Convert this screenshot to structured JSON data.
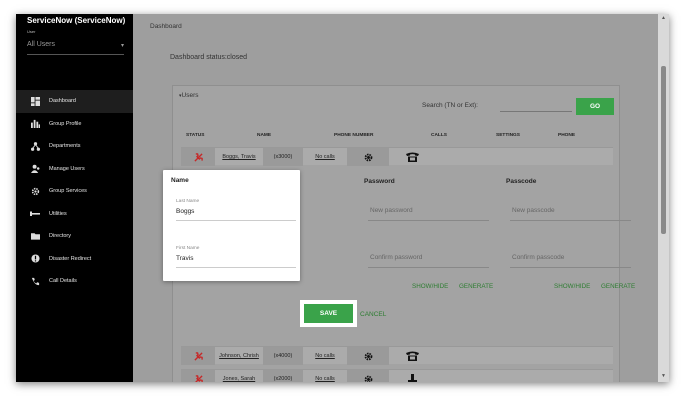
{
  "sidebar": {
    "app_title": "ServiceNow (ServiceNow)",
    "user_label": "User",
    "user_select": "All Users",
    "items": [
      {
        "label": "Dashboard",
        "icon": "dashboard-icon"
      },
      {
        "label": "Group Profile",
        "icon": "bar-chart-icon"
      },
      {
        "label": "Departments",
        "icon": "org-chart-icon"
      },
      {
        "label": "Manage Users",
        "icon": "users-icon"
      },
      {
        "label": "Group Services",
        "icon": "gear-icon"
      },
      {
        "label": "Utilities",
        "icon": "wrench-icon"
      },
      {
        "label": "Directory",
        "icon": "folder-icon"
      },
      {
        "label": "Disaster Redirect",
        "icon": "alert-icon"
      },
      {
        "label": "Call Details",
        "icon": "phone-icon"
      }
    ]
  },
  "main": {
    "breadcrumb": "Dashboard",
    "status": "Dashboard status:closed",
    "users_toggle": "Users",
    "search_label": "Search (TN or Ext):",
    "search_value": "",
    "go_label": "GO",
    "headers": {
      "status": "STATUS",
      "name": "NAME",
      "phone": "PHONE NUMBER",
      "calls": "CALLS",
      "settings": "SETTINGS",
      "phone_col": "PHONE"
    },
    "rows": [
      {
        "name": "Boggs, Travis",
        "ext": "(x3000)",
        "calls": "No calls"
      },
      {
        "name": "Johnson, Chrish",
        "ext": "(x4000)",
        "calls": "No calls"
      },
      {
        "name": "Jones, Sarah",
        "ext": "(x2000)",
        "calls": "No calls"
      }
    ],
    "edit": {
      "name_header": "Name",
      "last_name_label": "Last Name",
      "last_name": "Boggs",
      "first_name_label": "First Name",
      "first_name": "Travis",
      "password_header": "Password",
      "new_password": "New password",
      "confirm_password": "Confirm password",
      "passcode_header": "Passcode",
      "new_passcode": "New passcode",
      "confirm_passcode": "Confirm passcode",
      "show_hide": "SHOW/HIDE",
      "generate": "GENERATE",
      "save": "SAVE",
      "cancel": "CANCEL"
    }
  },
  "colors": {
    "accent_green": "#3aa34a",
    "status_red": "#c62828",
    "sidebar_bg": "#000000"
  }
}
